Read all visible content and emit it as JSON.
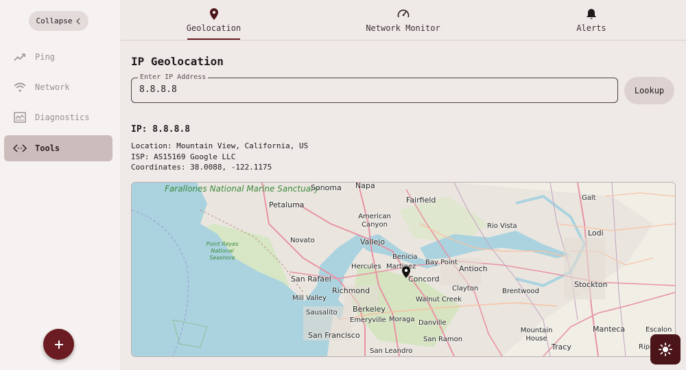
{
  "sidebar": {
    "collapse_label": "Collapse",
    "items": [
      {
        "label": "Ping",
        "icon": "trending-up-icon"
      },
      {
        "label": "Network",
        "icon": "wifi-icon"
      },
      {
        "label": "Diagnostics",
        "icon": "chart-monitor-icon"
      },
      {
        "label": "Tools",
        "icon": "code-icon",
        "active": true
      }
    ],
    "fab_icon": "plus-icon"
  },
  "tabs": [
    {
      "label": "Geolocation",
      "icon": "location-pin-icon",
      "active": true
    },
    {
      "label": "Network Monitor",
      "icon": "speedometer-icon"
    },
    {
      "label": "Alerts",
      "icon": "bell-icon"
    }
  ],
  "main": {
    "title": "IP Geolocation",
    "input": {
      "legend": "Enter IP Address",
      "value": "8.8.8.8"
    },
    "lookup_label": "Lookup",
    "result": {
      "ip_line": "IP: 8.8.8.8",
      "location_line": "Location: Mountain View, California, US",
      "isp_line": "ISP: AS15169 Google LLC",
      "coords_line": "Coordinates: 38.0088, -122.1175"
    }
  },
  "map": {
    "places": [
      "Sonoma",
      "Napa",
      "Petaluma",
      "Fairfield",
      "American Canyon",
      "Rio Vista",
      "Galt",
      "Lodi",
      "Novato",
      "Vallejo",
      "Benicia",
      "Hercules",
      "Martinez",
      "Bay Point",
      "Antioch",
      "Concord",
      "San Rafael",
      "Richmond",
      "Mill Valley",
      "Clayton",
      "Brentwood",
      "Stockton",
      "Walnut Creek",
      "Berkeley",
      "Sausalito",
      "Emeryville",
      "Moraga",
      "Danville",
      "San Francisco",
      "San Ramon",
      "Mountain House",
      "Manteca",
      "Tracy",
      "Escalon",
      "San Leandro",
      "Ripon"
    ],
    "parks": [
      "Farallones National Marine Sanctuary",
      "Point Reyes National Seashore"
    ],
    "marker_icon": "map-marker-icon"
  },
  "theme_icon": "sun-icon",
  "colors": {
    "accent": "#6b1c22",
    "active_nav": "#cdbcbc",
    "water": "#aad3df"
  }
}
